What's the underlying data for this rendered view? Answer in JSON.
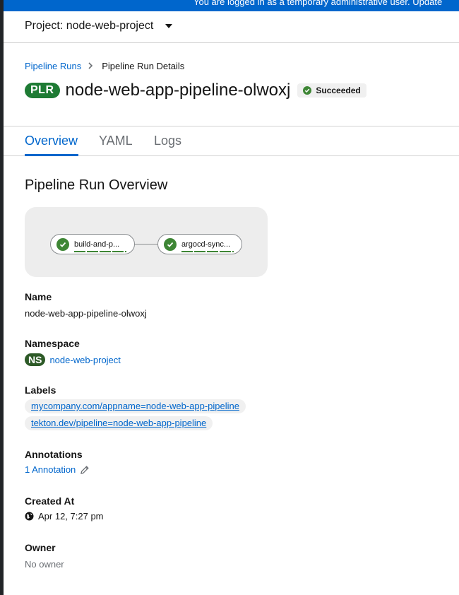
{
  "banner": {
    "text": "You are logged in as a temporary administrative user. Update"
  },
  "project": {
    "label": "Project: node-web-project"
  },
  "breadcrumb": {
    "parent": "Pipeline Runs",
    "current": "Pipeline Run Details"
  },
  "header": {
    "badge": "PLR",
    "title": "node-web-app-pipeline-olwoxj",
    "status": "Succeeded"
  },
  "tabs": [
    {
      "label": "Overview",
      "active": true
    },
    {
      "label": "YAML",
      "active": false
    },
    {
      "label": "Logs",
      "active": false
    }
  ],
  "overview": {
    "title": "Pipeline Run Overview",
    "tasks": [
      {
        "label": "build-and-p...",
        "status": "success"
      },
      {
        "label": "argocd-sync...",
        "status": "success"
      }
    ]
  },
  "details": {
    "name_label": "Name",
    "name_value": "node-web-app-pipeline-olwoxj",
    "namespace_label": "Namespace",
    "namespace_badge": "NS",
    "namespace_value": "node-web-project",
    "labels_label": "Labels",
    "labels": [
      "mycompany.com/appname=node-web-app-pipeline",
      "tekton.dev/pipeline=node-web-app-pipeline"
    ],
    "annotations_label": "Annotations",
    "annotations_link": "1 Annotation",
    "created_label": "Created At",
    "created_value": "Apr 12, 7:27 pm",
    "owner_label": "Owner",
    "owner_value": "No owner"
  },
  "colors": {
    "accent": "#0066cc",
    "success": "#3e8635",
    "banner": "#0066cc"
  }
}
